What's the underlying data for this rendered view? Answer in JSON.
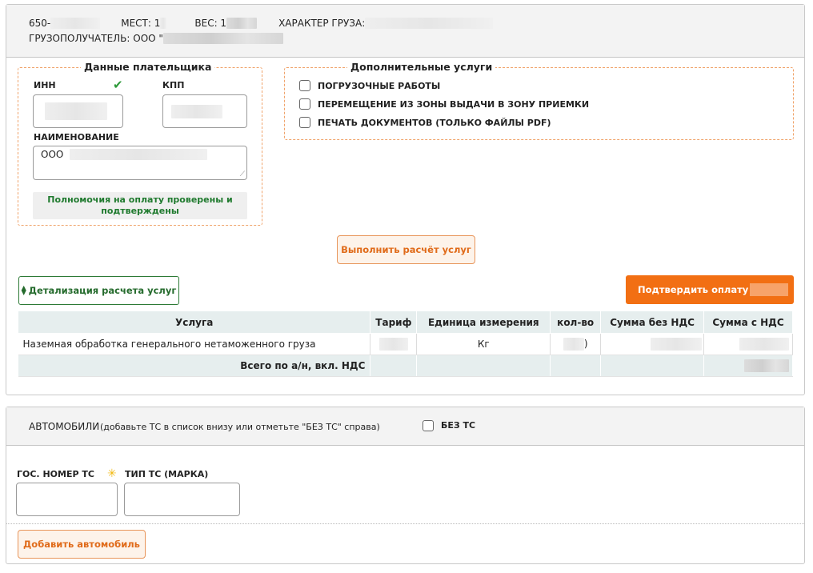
{
  "cargo_header": {
    "awb_prefix": "650-",
    "places_label": "МЕСТ: 1",
    "weight_label": "ВЕС: 1",
    "cargo_type_label": "ХАРАКТЕР ГРУЗА: ",
    "consignee_label": "ГРУЗОПОЛУЧАТЕЛЬ: ООО \""
  },
  "payer": {
    "title": "Данные плательщика",
    "inn_label": "ИНН",
    "kpp_label": "КПП",
    "name_label": "НАИМЕНОВАНИЕ",
    "name_value_prefix": "ООО",
    "authority_status": "Полномочия на оплату проверены и подтверждены",
    "inn_valid_icon": "checkmark-icon",
    "status_color": "#1f7a2e"
  },
  "services": {
    "title": "Дополнительные услуги",
    "options": [
      {
        "label": "ПОГРУЗОЧНЫЕ РАБОТЫ",
        "checked": false
      },
      {
        "label": "ПЕРЕМЕЩЕНИЕ ИЗ ЗОНЫ ВЫДАЧИ В ЗОНУ ПРИЕМКИ",
        "checked": false
      },
      {
        "label": "ПЕЧАТЬ ДОКУМЕНТОВ (ТОЛЬКО ФАЙЛЫ PDF)",
        "checked": false
      }
    ]
  },
  "actions": {
    "calculate_label": "Выполнить расчёт услуг",
    "details_label": "Детализация расчета услуг",
    "details_icon": "sort-arrows-icon",
    "confirm_label": "Подтвердить оплату ",
    "accent_color": "#f26f13"
  },
  "table": {
    "headers": [
      "Услуга",
      "Тариф",
      "Единица измерения",
      "кол-во",
      "Сумма без НДС",
      "Сумма с НДС"
    ],
    "rows": [
      {
        "service": "Наземная обработка генерального нетаможенного груза",
        "unit": "Кг",
        "qty_suffix": ")"
      }
    ],
    "total_label": "Всего по а/н, вкл. НДС"
  },
  "vehicles": {
    "title": "АВТОМОБИЛИ",
    "hint": "(добавьте ТС в список внизу или отметьте \"БЕЗ ТС\" справа)",
    "no_vehicle_label": "БЕЗ ТС",
    "plate_label": "ГОС. НОМЕР ТС",
    "type_label": "ТИП ТС (МАРКА)",
    "required_icon": "asterisk-icon",
    "add_button_label": "Добавить автомобиль"
  }
}
